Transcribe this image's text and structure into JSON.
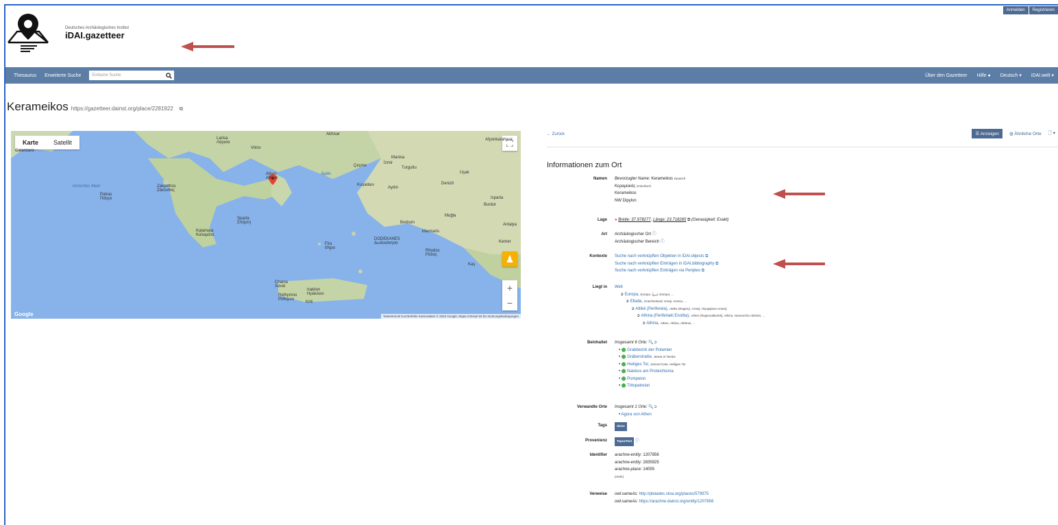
{
  "header": {
    "login": "Anmelden",
    "register": "Registrieren",
    "institute": "Deutsches Archäologisches Institut",
    "app_name": "iDAI.gazetteer"
  },
  "nav": {
    "thesaurus": "Thesaurus",
    "advanced_search": "Erweiterte Suche",
    "search_placeholder": "Einfache Suche",
    "about": "Über den Gazetteer",
    "help": "Hilfe",
    "language": "Deutsch",
    "world": "iDAI.welt"
  },
  "page": {
    "title": "Kerameikos",
    "url": "https://gazetteer.dainst.org/place/2281922"
  },
  "map": {
    "tab_map": "Karte",
    "tab_satellite": "Satellit",
    "footer": "Tastenkürzel   Kurzbefehle   Kartendaten © 2022 Google, Mapa GISrael   50 km   Nutzungsbedingungen",
    "google": "Google",
    "labels": [
      {
        "t": "Catanzaro"
      },
      {
        "t": "Larisa\nΛάρισα"
      },
      {
        "t": "Volos"
      },
      {
        "t": "Akhisar"
      },
      {
        "t": "Uşak"
      },
      {
        "t": "Afyonkarahisar"
      },
      {
        "t": "Manisa"
      },
      {
        "t": "İzmir"
      },
      {
        "t": "Turgutlu"
      },
      {
        "t": "Çeşme"
      },
      {
        "t": "Patras\nΠάτρα"
      },
      {
        "t": "Athen\nΑθήνα"
      },
      {
        "t": "Kuşadası"
      },
      {
        "t": "Aydın"
      },
      {
        "t": "Denizli"
      },
      {
        "t": "Isparta"
      },
      {
        "t": "Burdur"
      },
      {
        "t": "Zakynthos\nΖάκυνθος"
      },
      {
        "t": "Muğla"
      },
      {
        "t": "Sparta\nΣπάρτη"
      },
      {
        "t": "Bodrum"
      },
      {
        "t": "Marmaris"
      },
      {
        "t": "Antalya"
      },
      {
        "t": "Kemer"
      },
      {
        "t": "Kalamata\nΚαλαμάτα"
      },
      {
        "t": "DODEKANES\nΔωδεκάνησα"
      },
      {
        "t": "Rhodos\nΡόδος"
      },
      {
        "t": "Fira\nΘήρα"
      },
      {
        "t": "Kaş"
      },
      {
        "t": "Chania\nΧανιά"
      },
      {
        "t": "Iraklion\nΗράκλειο"
      },
      {
        "t": "Rethymno\nΡέθυμνο"
      },
      {
        "t": "Kriti"
      },
      {
        "t": "Ionisches Meer"
      },
      {
        "t": "Ägäis"
      }
    ]
  },
  "panel": {
    "back": "← Zurück",
    "show": "Anzeigen",
    "similar": "Ähnliche Orte",
    "heading": "Informationen zum Ort",
    "names_label": "Namen",
    "names_pref_prefix": "Bevorzugter Name:",
    "names": [
      {
        "name": "Kerameikos",
        "lang": "Deutsch"
      },
      {
        "name": "Κεραμεικός",
        "lang": "Griechisch"
      },
      {
        "name": "Kerameikos",
        "lang": ""
      },
      {
        "name": "NW Dipylon",
        "lang": ""
      }
    ],
    "location_label": "Lage",
    "location_lat": "Breite: 37.978277",
    "location_lon": "Länge: 23.718265",
    "location_precision": "(Genauigkeit: Exakt)",
    "type_label": "Art",
    "types": [
      "Archäologischer Ort",
      "Archäologischer Bereich"
    ],
    "context_label": "Kontexte",
    "contexts": [
      "Suche nach verknüpften Objekten in iDAI.objects",
      "Suche nach verknüpften Einträgen in iDAI.bibliography",
      "Suche nach verknüpften Einträgen via Peripleo"
    ],
    "located_label": "Liegt in",
    "located": [
      {
        "name": "Welt",
        "alt": ""
      },
      {
        "name": "Europa,",
        "alt": "Europa, ليروأ, Europa, ..."
      },
      {
        "name": "Ellada,",
        "alt": "Griechenland, Greqi, Grecia, ..."
      },
      {
        "name": "Attikē (Perifereia),",
        "alt": "Attiko (Region), Αττική, Περιφέρεια Αττικής"
      },
      {
        "name": "Athina (Periferiaki Enotita),",
        "alt": "Athen (Regionalbezirk), Athina, Nomarchía Athinón, ..."
      },
      {
        "name": "Athina,",
        "alt": "Athen, Athina, Athēnai, ..."
      }
    ],
    "contains_label": "Beinhaltet",
    "contains_total": "Insgesamt 6 Orte:",
    "contains": [
      {
        "name": "Grabbezirk der Potamier",
        "alt": ""
      },
      {
        "name": "Gräberstraße,",
        "alt": "Street of Tombs"
      },
      {
        "name": "Heiliges Tor,",
        "alt": "Sacred Gate, Heiliges Tor"
      },
      {
        "name": "Naiskos am Proteichisma",
        "alt": ""
      },
      {
        "name": "Pompeion",
        "alt": ""
      },
      {
        "name": "Tritopatreion",
        "alt": ""
      }
    ],
    "related_label": "Verwandte Orte",
    "related_total": "Insgesamt 1 Orte:",
    "related": [
      "Agora von Athen"
    ],
    "tags_label": "Tags",
    "tags": [
      "deme"
    ],
    "prov_label": "Provenienz",
    "prov": "ToposText",
    "ident_label": "Identifier",
    "identifiers": [
      {
        "k": "arachne-entity:",
        "v": "1207856"
      },
      {
        "k": "arachne-entity:",
        "v": "2835925"
      },
      {
        "k": "arachne-place:",
        "v": "14055"
      }
    ],
    "more": "(mehr)",
    "refs_label": "Verweise",
    "refs": [
      {
        "k": "owl:sameAs:",
        "v": "http://pleiades.stoa.org/places/579975"
      },
      {
        "k": "owl:sameAs:",
        "v": "https://arachne.dainst.org/entity/1207856"
      }
    ]
  },
  "colors": {
    "navbar": "#5c7ea6",
    "arrow": "#c0504d",
    "link": "#2c6cb0",
    "sea": "#87b3ea",
    "land": "#c9d9b0"
  }
}
